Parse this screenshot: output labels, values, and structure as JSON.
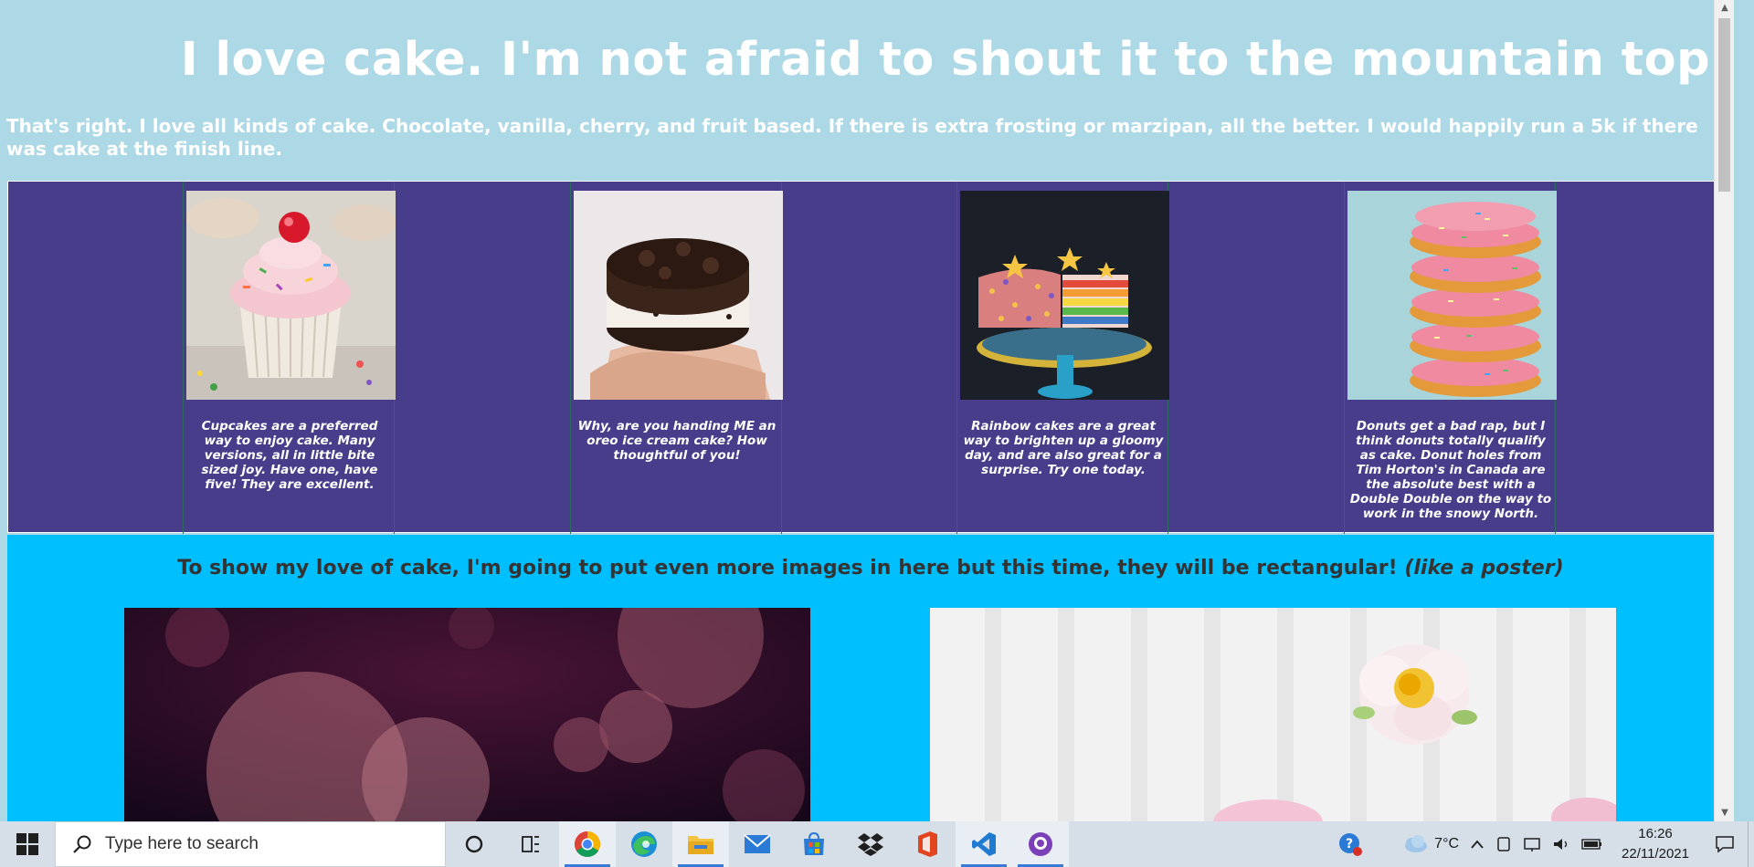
{
  "header": {
    "title": "I love cake. I'm not afraid to shout it to the mountain top.",
    "intro": "That's right. I love all kinds of cake. Chocolate, vanilla, cherry, and fruit based. If there is extra frosting or marzipan, all the better. I would happily run a 5k if there was cake at the finish line."
  },
  "gallery": {
    "cards": [
      {
        "caption": "Cupcakes are a preferred way to enjoy cake. Many versions, all in little bite sized joy. Have one, have five! They are excellent."
      },
      {
        "caption": "Why, are you handing ME an oreo ice cream cake? How thoughtful of you!"
      },
      {
        "caption": "Rainbow cakes are a great way to brighten up a gloomy day, and are also great for a surprise. Try one today."
      },
      {
        "caption": "Donuts get a bad rap, but I think donuts totally qualify as cake. Donut holes from Tim Horton's in Canada are the absolute best with a Double Double on the way to work in the snowy North."
      }
    ]
  },
  "section2": {
    "heading_main": "To show my love of cake, I'm going to put even more images in here but this time, they will be rectangular! ",
    "heading_italic": "(like a poster)"
  },
  "taskbar": {
    "search_placeholder": "Type here to search",
    "weather": "7°C",
    "time": "16:26",
    "date": "22/11/2021",
    "apps": [
      "cortana-icon",
      "task-view-icon",
      "chrome-icon",
      "edge-icon",
      "file-explorer-icon",
      "mail-icon",
      "store-icon",
      "dropbox-icon",
      "office-icon",
      "vscode-icon",
      "github-desktop-icon"
    ]
  },
  "colors": {
    "page_background": "#add8e6",
    "gallery_background": "#483d8b",
    "section2_background": "#00bfff",
    "heading_text": "#ffffff"
  }
}
